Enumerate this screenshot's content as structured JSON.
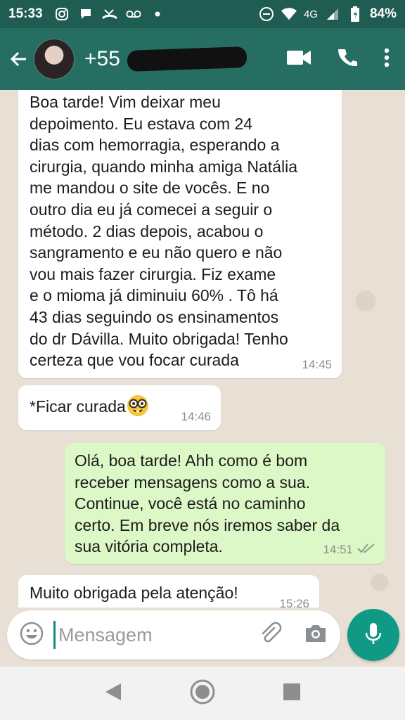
{
  "status_bar": {
    "time": "15:33",
    "network": "4G",
    "battery": "84%",
    "icons_left": [
      "instagram-icon",
      "chat-bubble-icon",
      "missed-call-icon",
      "voicemail-icon",
      "dot-icon"
    ],
    "icons_right": [
      "dnd-icon",
      "wifi-icon",
      "signal-icon",
      "battery-icon"
    ]
  },
  "header": {
    "contact_prefix": "+55",
    "accent_color": "#266e62",
    "actions": [
      "video-call-icon",
      "phone-call-icon",
      "more-options-icon"
    ]
  },
  "messages": [
    {
      "direction": "incoming",
      "text": "Boa tarde! Vim deixar meu\ndepoimento. Eu estava com 24\ndias com hemorragia, esperando a\ncirurgia, quando minha amiga Natália\nme mandou o site de vocês. E no\noutro dia eu já comecei a seguir o\nmétodo. 2 dias depois, acabou o\nsangramento e eu não quero e não\nvou mais fazer cirurgia. Fiz exame\ne o mioma já diminuiu 60% . Tô há\n43 dias seguindo os ensinamentos\ndo dr Dávilla. Muito obrigada! Tenho\ncerteza que vou focar curada",
      "time": "14:45"
    },
    {
      "direction": "incoming",
      "text": "*Ficar curada",
      "emoji": "nerd-face-emoji",
      "time": "14:46"
    },
    {
      "direction": "outgoing",
      "text": "Olá, boa tarde! Ahh como é bom\nreceber mensagens como a sua.\nContinue, você está no caminho\ncerto. Em breve nós iremos saber da\nsua vitória completa.",
      "time": "14:51",
      "status": "read-checkmarks-icon"
    },
    {
      "direction": "incoming",
      "text": "Muito obrigada pela atenção!",
      "time": "15:26"
    }
  ],
  "input": {
    "placeholder": "Mensagem",
    "icons": [
      "emoji-icon",
      "attach-icon",
      "camera-icon",
      "mic-icon"
    ]
  },
  "nav": [
    "back-nav-icon",
    "home-nav-icon",
    "recents-nav-icon"
  ]
}
